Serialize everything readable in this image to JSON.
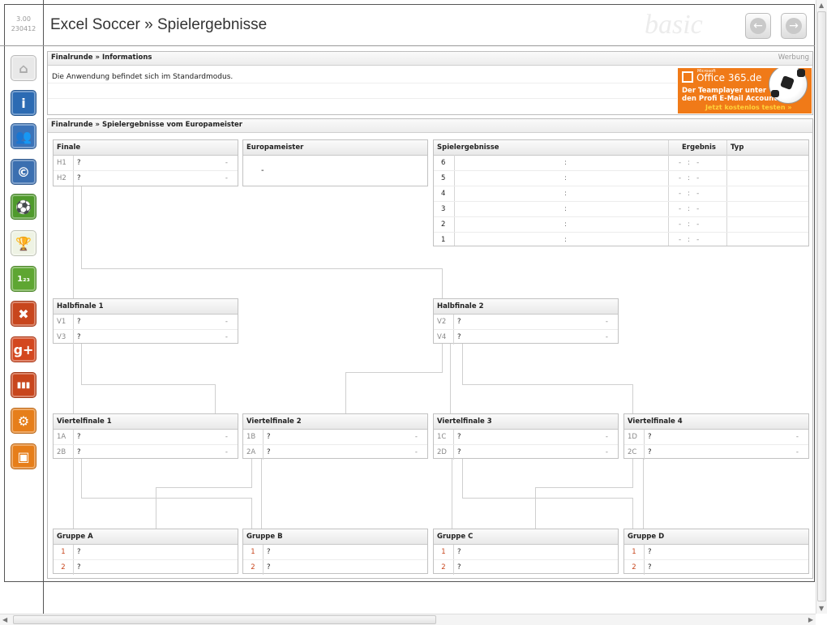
{
  "version": {
    "number": "3.00",
    "build": "230412"
  },
  "title": "Excel Soccer » Spielergebnisse",
  "edition": "basic",
  "info_panel": {
    "title": "Finalrunde » Informations",
    "ad_label": "Werbung",
    "message": "Die Anwendung befindet sich im Standardmodus."
  },
  "ad": {
    "brand_small": "Microsoft",
    "brand": "Office 365.de",
    "line1": "Der Teamplayer unter",
    "line2": "den Profi E-Mail Accounts!",
    "cta": "Jetzt kostenlos testen »",
    "bg_color": "#f07a18"
  },
  "results_panel": {
    "title": "Finalrunde » Spielergebnisse vom Europameister"
  },
  "finale": {
    "title": "Finale",
    "rows": [
      {
        "code": "H1",
        "name": "?",
        "score": "-"
      },
      {
        "code": "H2",
        "name": "?",
        "score": "-"
      }
    ]
  },
  "europameister": {
    "title": "Europameister",
    "value": "-"
  },
  "spielergebnisse": {
    "title": "Spielergebnisse",
    "col_ergebnis": "Ergebnis",
    "col_typ": "Typ",
    "rows": [
      {
        "n": "6",
        "sep": ":",
        "res": "-   :   -"
      },
      {
        "n": "5",
        "sep": ":",
        "res": "-   :   -"
      },
      {
        "n": "4",
        "sep": ":",
        "res": "-   :   -"
      },
      {
        "n": "3",
        "sep": ":",
        "res": "-   :   -"
      },
      {
        "n": "2",
        "sep": ":",
        "res": "-   :   -"
      },
      {
        "n": "1",
        "sep": ":",
        "res": "-   :   -"
      }
    ]
  },
  "halbfinale1": {
    "title": "Halbfinale 1",
    "rows": [
      {
        "code": "V1",
        "name": "?",
        "score": "-"
      },
      {
        "code": "V3",
        "name": "?",
        "score": "-"
      }
    ]
  },
  "halbfinale2": {
    "title": "Halbfinale 2",
    "rows": [
      {
        "code": "V2",
        "name": "?",
        "score": "-"
      },
      {
        "code": "V4",
        "name": "?",
        "score": "-"
      }
    ]
  },
  "viertelfinale1": {
    "title": "Viertelfinale 1",
    "rows": [
      {
        "code": "1A",
        "name": "?",
        "score": "-"
      },
      {
        "code": "2B",
        "name": "?",
        "score": "-"
      }
    ]
  },
  "viertelfinale2": {
    "title": "Viertelfinale 2",
    "rows": [
      {
        "code": "1B",
        "name": "?",
        "score": "-"
      },
      {
        "code": "2A",
        "name": "?",
        "score": "-"
      }
    ]
  },
  "viertelfinale3": {
    "title": "Viertelfinale 3",
    "rows": [
      {
        "code": "1C",
        "name": "?",
        "score": "-"
      },
      {
        "code": "2D",
        "name": "?",
        "score": "-"
      }
    ]
  },
  "viertelfinale4": {
    "title": "Viertelfinale 4",
    "rows": [
      {
        "code": "1D",
        "name": "?",
        "score": "-"
      },
      {
        "code": "2C",
        "name": "?",
        "score": "-"
      }
    ]
  },
  "gruppeA": {
    "title": "Gruppe A",
    "rows": [
      {
        "code": "1",
        "name": "?"
      },
      {
        "code": "2",
        "name": "?"
      }
    ]
  },
  "gruppeB": {
    "title": "Gruppe B",
    "rows": [
      {
        "code": "1",
        "name": "?"
      },
      {
        "code": "2",
        "name": "?"
      }
    ]
  },
  "gruppeC": {
    "title": "Gruppe C",
    "rows": [
      {
        "code": "1",
        "name": "?"
      },
      {
        "code": "2",
        "name": "?"
      }
    ]
  },
  "gruppeD": {
    "title": "Gruppe D",
    "rows": [
      {
        "code": "1",
        "name": "?"
      },
      {
        "code": "2",
        "name": "?"
      }
    ]
  },
  "sidebar": [
    {
      "name": "home-icon",
      "glyph": "⌂",
      "color": "#e8e8e8",
      "fg": "#aaaaaa"
    },
    {
      "name": "info-icon",
      "glyph": "i",
      "color": "#2c6bb3",
      "fg": "#ffffff"
    },
    {
      "name": "users-icon",
      "glyph": "👥",
      "color": "#3b73b8",
      "fg": "#ffffff"
    },
    {
      "name": "copyright-icon",
      "glyph": "©",
      "color": "#3b6fb0",
      "fg": "#ffffff"
    },
    {
      "name": "soccer-ball-icon",
      "glyph": "⚽",
      "color": "#4f9a2c",
      "fg": "#ffffff"
    },
    {
      "name": "trophy-icon",
      "glyph": "🏆",
      "color": "#eef3e4",
      "fg": "#c9d6b0"
    },
    {
      "name": "ranking-icon",
      "glyph": "1₂₃",
      "color": "#5ea632",
      "fg": "#ffffff"
    },
    {
      "name": "tools-icon",
      "glyph": "✖",
      "color": "#c8461d",
      "fg": "#ffffff"
    },
    {
      "name": "google-plus-icon",
      "glyph": "g+",
      "color": "#d3471f",
      "fg": "#ffffff"
    },
    {
      "name": "statistics-icon",
      "glyph": "▮▮▮",
      "color": "#c8461d",
      "fg": "#ffffff"
    },
    {
      "name": "settings-gear-icon",
      "glyph": "⚙",
      "color": "#e67e1a",
      "fg": "#ffffff"
    },
    {
      "name": "save-icon",
      "glyph": "▣",
      "color": "#e67e1a",
      "fg": "#ffffff"
    }
  ]
}
